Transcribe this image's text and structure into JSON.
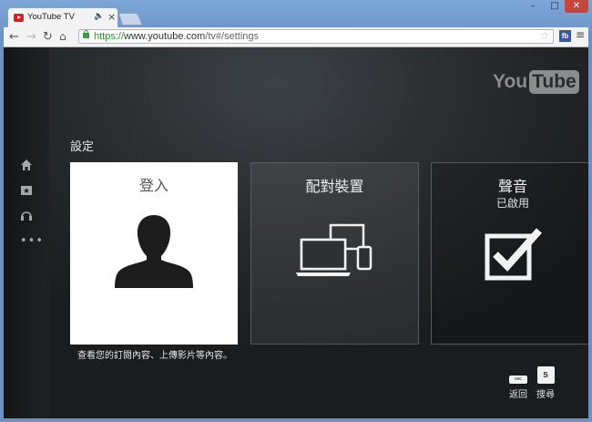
{
  "browser": {
    "tab_title": "YouTube TV",
    "tab_audio_icon": "speaker-icon",
    "tab_close": "×",
    "window_minimize": "–",
    "window_maximize": "□",
    "window_close": "✕",
    "url_scheme": "https://",
    "url_host": "www.youtube.com",
    "url_path": "/tv#/settings",
    "extension_label": "fb",
    "nav": {
      "back": "←",
      "forward": "→",
      "reload": "C",
      "home": "⌂",
      "menu": "≡",
      "star": "☆"
    }
  },
  "page": {
    "logo_you": "You",
    "logo_tube": "Tube",
    "section_title": "設定",
    "cards": [
      {
        "title": "登入",
        "subtitle": "",
        "icon": "person-icon"
      },
      {
        "title": "配對裝置",
        "subtitle": "",
        "icon": "devices-icon"
      },
      {
        "title": "聲音",
        "subtitle": "已啟用",
        "icon": "checkbox-checked-icon"
      }
    ],
    "signin_description": "查看您的訂閱內容、上傳影片等內容。",
    "keys": [
      {
        "cap": "esc",
        "label": "返回"
      },
      {
        "cap": "S",
        "label": "搜尋"
      }
    ],
    "rail": [
      "home-icon",
      "subscriptions-icon",
      "music-icon",
      "more-icon"
    ]
  },
  "colors": {
    "window_frame": "#6d93c7",
    "page_background": "#272a2d",
    "signin_card": "#ffffff",
    "favicon_red": "#d71f1f",
    "secure_green": "#2c8c2c"
  }
}
